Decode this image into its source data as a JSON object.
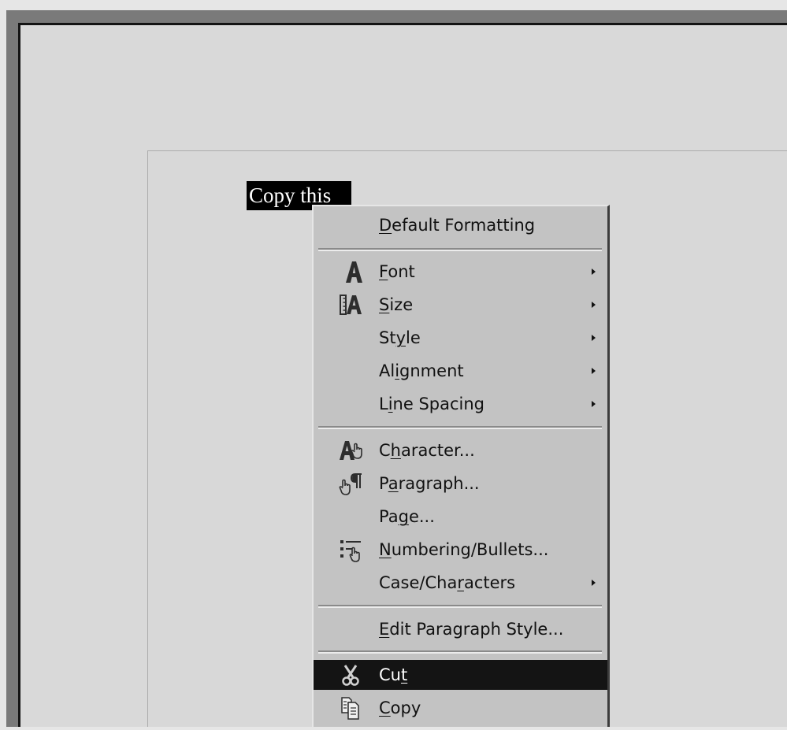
{
  "document": {
    "selected_text": "Copy this"
  },
  "context_menu": {
    "items": [
      {
        "label": "Default Formatting",
        "mnemonic": "D",
        "icon": "",
        "submenu": false
      },
      {
        "label": "Font",
        "mnemonic": "F",
        "icon": "font-icon",
        "submenu": true
      },
      {
        "label": "Size",
        "mnemonic": "S",
        "icon": "font-size-icon",
        "submenu": true
      },
      {
        "label": "Style",
        "mnemonic": "y",
        "icon": "",
        "submenu": true
      },
      {
        "label": "Alignment",
        "mnemonic": "i",
        "icon": "",
        "submenu": true
      },
      {
        "label": "Line Spacing",
        "mnemonic": "i",
        "icon": "",
        "submenu": true
      },
      {
        "label": "Character...",
        "mnemonic": "h",
        "icon": "character-dialog-icon",
        "submenu": false
      },
      {
        "label": "Paragraph...",
        "mnemonic": "a",
        "icon": "paragraph-dialog-icon",
        "submenu": false
      },
      {
        "label": "Page...",
        "mnemonic": "g",
        "icon": "",
        "submenu": false
      },
      {
        "label": "Numbering/Bullets...",
        "mnemonic": "N",
        "icon": "numbering-bullets-icon",
        "submenu": false
      },
      {
        "label": "Case/Characters",
        "mnemonic": "r",
        "icon": "",
        "submenu": true
      },
      {
        "label": "Edit Paragraph Style...",
        "mnemonic": "E",
        "icon": "",
        "submenu": false
      },
      {
        "label": "Cut",
        "mnemonic": "t",
        "icon": "scissors-icon",
        "submenu": false,
        "highlighted": true
      },
      {
        "label": "Copy",
        "mnemonic": "C",
        "icon": "copy-icon",
        "submenu": false
      }
    ]
  }
}
